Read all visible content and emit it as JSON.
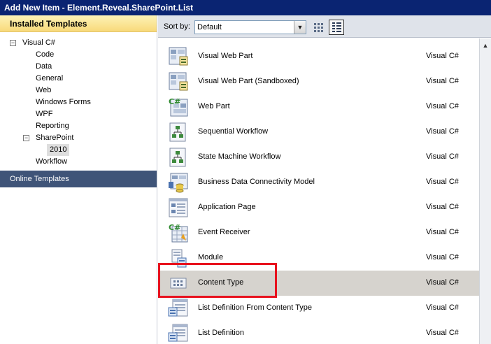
{
  "window": {
    "title": "Add New Item - Element.Reveal.SharePoint.List"
  },
  "left_panel": {
    "installed_header": "Installed Templates",
    "tree": {
      "visual_csharp": "Visual C#",
      "code": "Code",
      "data": "Data",
      "general": "General",
      "web": "Web",
      "windows_forms": "Windows Forms",
      "wpf": "WPF",
      "reporting": "Reporting",
      "sharepoint": "SharePoint",
      "sharepoint_2010": "2010",
      "workflow": "Workflow"
    },
    "online_header": "Online Templates"
  },
  "sortbar": {
    "label": "Sort by:",
    "selected": "Default",
    "views": [
      "small-icons",
      "medium-icons"
    ]
  },
  "templates": [
    {
      "name": "Visual Web Part",
      "language": "Visual C#",
      "icon": "visual-web-part-icon"
    },
    {
      "name": "Visual Web Part (Sandboxed)",
      "language": "Visual C#",
      "icon": "visual-web-part-sandboxed-icon"
    },
    {
      "name": "Web Part",
      "language": "Visual C#",
      "icon": "web-part-icon"
    },
    {
      "name": "Sequential Workflow",
      "language": "Visual C#",
      "icon": "sequential-workflow-icon"
    },
    {
      "name": "State Machine Workflow",
      "language": "Visual C#",
      "icon": "state-machine-workflow-icon"
    },
    {
      "name": "Business Data Connectivity Model",
      "language": "Visual C#",
      "icon": "bdc-model-icon"
    },
    {
      "name": "Application Page",
      "language": "Visual C#",
      "icon": "application-page-icon"
    },
    {
      "name": "Event Receiver",
      "language": "Visual C#",
      "icon": "event-receiver-icon"
    },
    {
      "name": "Module",
      "language": "Visual C#",
      "icon": "module-icon"
    },
    {
      "name": "Content Type",
      "language": "Visual C#",
      "icon": "content-type-icon",
      "selected": true
    },
    {
      "name": "List Definition From Content Type",
      "language": "Visual C#",
      "icon": "list-definition-from-content-type-icon"
    },
    {
      "name": "List Definition",
      "language": "Visual C#",
      "icon": "list-definition-icon"
    }
  ],
  "colors": {
    "title_bar": "#0a2472",
    "selection": "#d6d3ce",
    "annotation": "#e8121e",
    "online_header": "#3f5478"
  }
}
